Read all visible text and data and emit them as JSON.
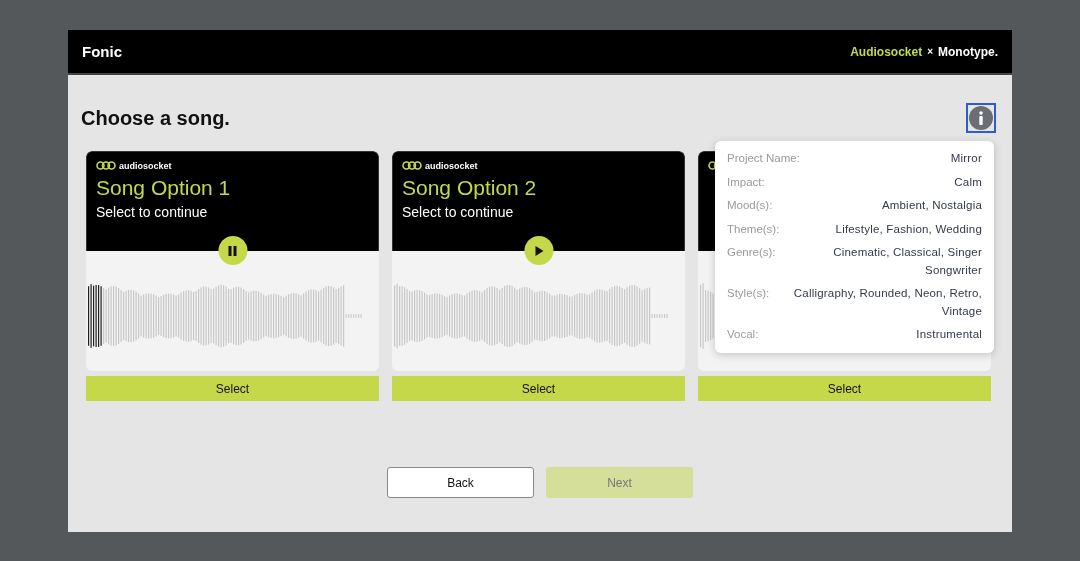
{
  "header": {
    "app_name": "Fonic",
    "partner": "Audiosocket",
    "separator": "×",
    "brand": "Monotype."
  },
  "page": {
    "title": "Choose a song."
  },
  "cards": [
    {
      "logo": "audiosocket",
      "title": "Song Option 1",
      "subtitle": "Select to continue",
      "playing": true,
      "level": 0.05,
      "button": "Select"
    },
    {
      "logo": "audiosocket",
      "title": "Song Option 2",
      "subtitle": "Select to continue",
      "playing": false,
      "button": "Select"
    },
    {
      "button": "Select"
    }
  ],
  "info_popover": {
    "rows": [
      {
        "label": "Project Name:",
        "value": "Mirror"
      },
      {
        "label": "Impact:",
        "value": "Calm"
      },
      {
        "label": "Mood(s):",
        "value": "Ambient, Nostalgia"
      },
      {
        "label": "Theme(s):",
        "value": "Lifestyle, Fashion, Wedding"
      },
      {
        "label": "Genre(s):",
        "value": "Cinematic, Classical, Singer Songwriter"
      },
      {
        "label": "Style(s):",
        "value": "Calligraphy, Rounded, Neon, Retro, Vintage"
      },
      {
        "label": "Vocal:",
        "value": "Instrumental"
      }
    ]
  },
  "footer": {
    "back": "Back",
    "next": "Next",
    "next_disabled": true
  }
}
